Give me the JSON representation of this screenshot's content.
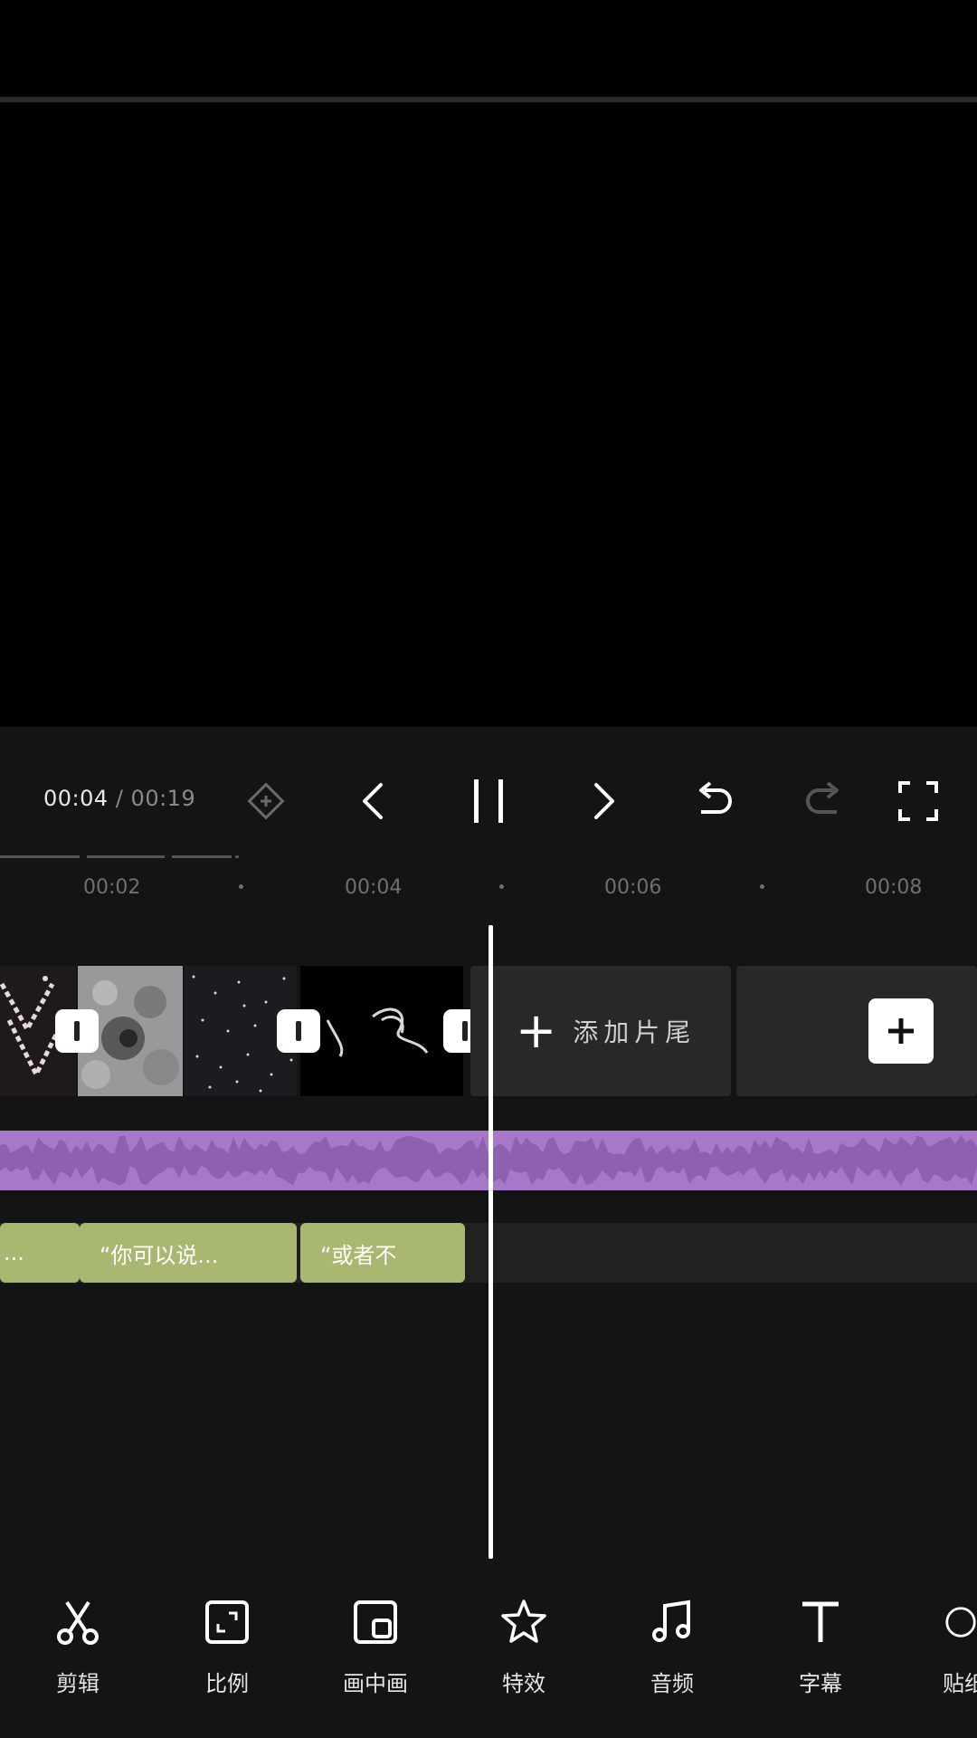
{
  "player": {
    "current_time": "00:04",
    "separator": "/",
    "total_time": "00:19"
  },
  "controls": [
    {
      "name": "keyframe-icon"
    },
    {
      "name": "previous-icon"
    },
    {
      "name": "pause-icon"
    },
    {
      "name": "next-icon"
    },
    {
      "name": "undo-icon"
    },
    {
      "name": "redo-icon"
    },
    {
      "name": "fullscreen-icon"
    }
  ],
  "ruler": {
    "ticks": [
      "00:02",
      "00:04",
      "00:06",
      "00:08"
    ]
  },
  "timeline": {
    "add_ending_label": "添加片尾",
    "text_clips": [
      "...",
      "“你可以说...",
      "“或者不"
    ]
  },
  "toolbar": {
    "items": [
      {
        "label": "剪辑",
        "icon": "scissors-icon"
      },
      {
        "label": "比例",
        "icon": "ratio-icon"
      },
      {
        "label": "画中画",
        "icon": "picture-in-picture-icon"
      },
      {
        "label": "特效",
        "icon": "effects-star-icon"
      },
      {
        "label": "音频",
        "icon": "music-note-icon"
      },
      {
        "label": "字幕",
        "icon": "text-icon"
      },
      {
        "label": "贴纸",
        "icon": "sticker-icon"
      }
    ]
  },
  "colors": {
    "panel_bg": "#121514",
    "audio_track": "#a878c8",
    "text_clip": "#a8b870",
    "playhead": "#ffffff"
  }
}
